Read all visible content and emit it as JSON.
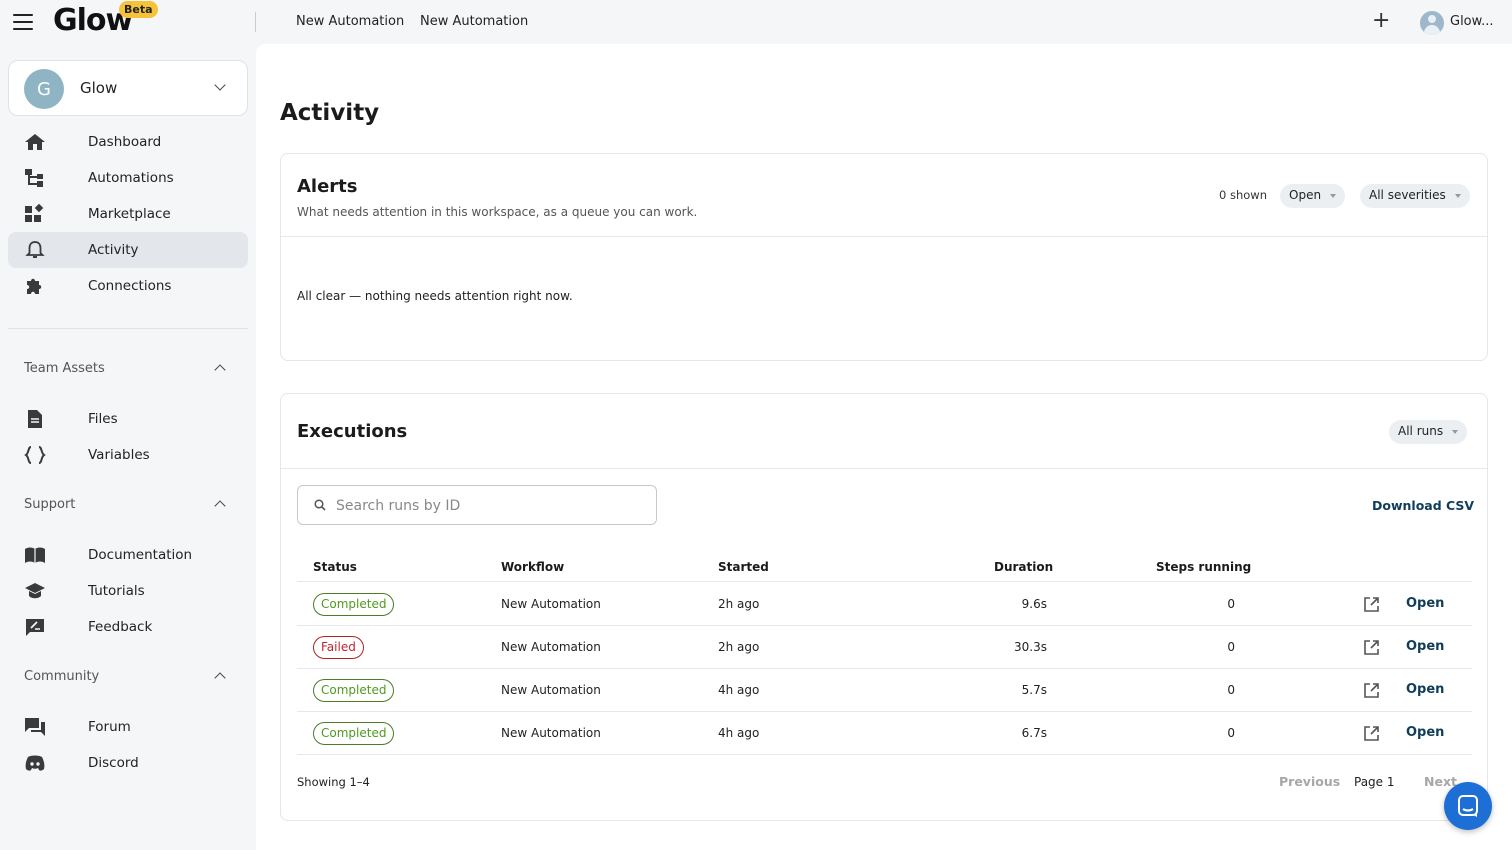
{
  "app": {
    "logo": "Glow",
    "beta": "Beta"
  },
  "topbar": {
    "crumbs": [
      "New Automation",
      "New Automation"
    ],
    "plus": "+",
    "user_name": "Glow..."
  },
  "workspace": {
    "initial": "G",
    "name": "Glow"
  },
  "nav": [
    {
      "label": "Dashboard",
      "icon": "home-icon"
    },
    {
      "label": "Automations",
      "icon": "flow-icon"
    },
    {
      "label": "Marketplace",
      "icon": "widgets-icon"
    },
    {
      "label": "Activity",
      "icon": "bell-icon",
      "active": true
    },
    {
      "label": "Connections",
      "icon": "puzzle-icon"
    }
  ],
  "sections": {
    "team": {
      "label": "Team Assets",
      "items": [
        {
          "label": "Files"
        },
        {
          "label": "Variables"
        }
      ]
    },
    "support": {
      "label": "Support",
      "items": [
        {
          "label": "Documentation"
        },
        {
          "label": "Tutorials"
        },
        {
          "label": "Feedback"
        }
      ]
    },
    "community": {
      "label": "Community",
      "items": [
        {
          "label": "Forum"
        },
        {
          "label": "Discord"
        }
      ]
    }
  },
  "page": {
    "title": "Activity"
  },
  "alerts": {
    "title": "Alerts",
    "subtitle": "What needs attention in this workspace, as a queue you can work.",
    "shown": "0 shown",
    "status_filter": "Open",
    "severity_filter": "All severities",
    "empty": "All clear — nothing needs attention right now."
  },
  "executions": {
    "title": "Executions",
    "filter": "All runs",
    "search_placeholder": "Search runs by ID",
    "download": "Download CSV",
    "columns": {
      "status": "Status",
      "workflow": "Workflow",
      "started": "Started",
      "duration": "Duration",
      "steps": "Steps running"
    },
    "rows": [
      {
        "status": "Completed",
        "workflow": "New Automation",
        "started": "2h ago",
        "duration": "9.6s",
        "steps": "0",
        "action": "Open"
      },
      {
        "status": "Failed",
        "workflow": "New Automation",
        "started": "2h ago",
        "duration": "30.3s",
        "steps": "0",
        "action": "Open"
      },
      {
        "status": "Completed",
        "workflow": "New Automation",
        "started": "4h ago",
        "duration": "5.7s",
        "steps": "0",
        "action": "Open"
      },
      {
        "status": "Completed",
        "workflow": "New Automation",
        "started": "4h ago",
        "duration": "6.7s",
        "steps": "0",
        "action": "Open"
      }
    ],
    "showing": "Showing 1–4",
    "prev": "Previous",
    "page": "Page 1",
    "next": "Next"
  },
  "colors": {
    "accent": "#103d5a",
    "success": "#4f9a1f",
    "error": "#c0262d",
    "fab": "#1d6fd6"
  }
}
